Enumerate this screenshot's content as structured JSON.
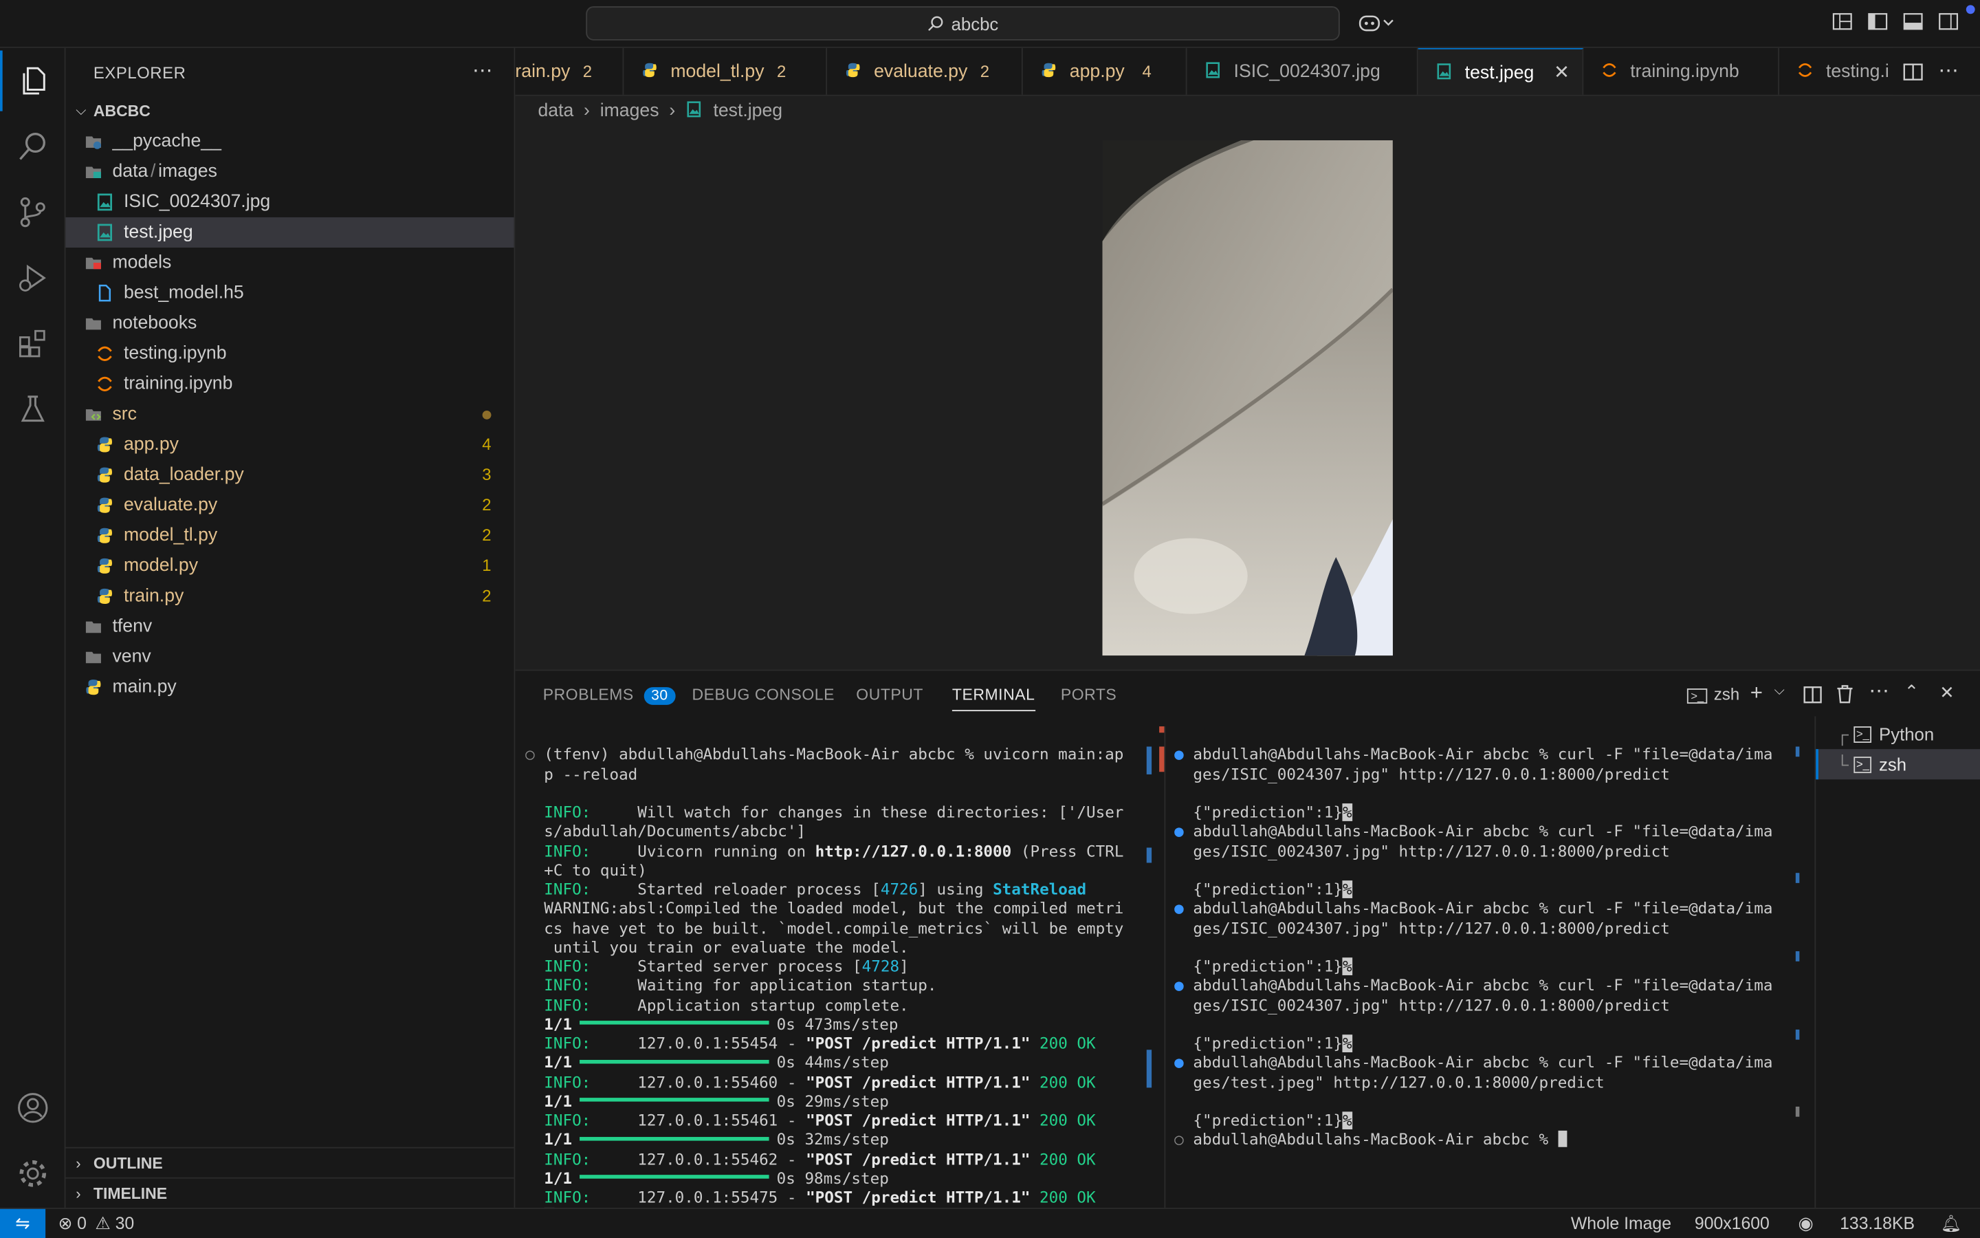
{
  "titlebar": {
    "search_text": "abcbc"
  },
  "sidebar": {
    "title": "EXPLORER",
    "root": "ABCBC",
    "items": [
      {
        "label": "__pycache__",
        "badge": ""
      },
      {
        "label_a": "data",
        "label_sep": "/",
        "label_b": "images",
        "badge": ""
      },
      {
        "label": "ISIC_0024307.jpg",
        "badge": ""
      },
      {
        "label": "test.jpeg",
        "badge": ""
      },
      {
        "label": "models",
        "badge": ""
      },
      {
        "label": "best_model.h5",
        "badge": ""
      },
      {
        "label": "notebooks",
        "badge": ""
      },
      {
        "label": "testing.ipynb",
        "badge": ""
      },
      {
        "label": "training.ipynb",
        "badge": ""
      },
      {
        "label": "src",
        "badge": ""
      },
      {
        "label": "app.py",
        "badge": "4"
      },
      {
        "label": "data_loader.py",
        "badge": "3"
      },
      {
        "label": "evaluate.py",
        "badge": "2"
      },
      {
        "label": "model_tl.py",
        "badge": "2"
      },
      {
        "label": "model.py",
        "badge": "1"
      },
      {
        "label": "train.py",
        "badge": "2"
      },
      {
        "label": "tfenv",
        "badge": ""
      },
      {
        "label": "venv",
        "badge": ""
      },
      {
        "label": "main.py",
        "badge": ""
      }
    ],
    "outline": "OUTLINE",
    "timeline": "TIMELINE"
  },
  "tabs": [
    {
      "label": "rain.py",
      "badge": "2"
    },
    {
      "label": "model_tl.py",
      "badge": "2"
    },
    {
      "label": "evaluate.py",
      "badge": "2"
    },
    {
      "label": "app.py",
      "badge": "4"
    },
    {
      "label": "ISIC_0024307.jpg",
      "badge": ""
    },
    {
      "label": "test.jpeg",
      "badge": ""
    },
    {
      "label": "training.ipynb",
      "badge": ""
    },
    {
      "label": "testing.i",
      "badge": ""
    }
  ],
  "breadcrumb": [
    "data",
    "images",
    "test.jpeg"
  ],
  "panel": {
    "tabs": [
      "PROBLEMS",
      "DEBUG CONSOLE",
      "OUTPUT",
      "TERMINAL",
      "PORTS"
    ],
    "problems_count": "30",
    "shell_label": "zsh",
    "terminals": [
      "Python",
      "zsh"
    ]
  },
  "terminal_left": {
    "l1": "(tfenv) abdullah@Abdullahs-MacBook-Air abcbc % uvicorn main:ap",
    "l2": "p --reload",
    "info_prefix": "INFO:",
    "l3": "     Will watch for changes in these directories: ['/User",
    "l4": "s/abdullah/Documents/abcbc']",
    "l5a": "     Uvicorn running on ",
    "l5b": "http://127.0.0.1:8000",
    "l5c": " (Press CTRL",
    "l6": "+C to quit)",
    "l7a": "     Started reloader process [",
    "l7b": "4726",
    "l7c": "] using ",
    "l7d": "StatReload",
    "l8": "WARNING:absl:Compiled the loaded model, but the compiled metri",
    "l9": "cs have yet to be built. `model.compile_metrics` will be empty",
    "l10": " until you train or evaluate the model.",
    "l11a": "     Started server process [",
    "l11b": "4728",
    "l11c": "]",
    "l12": "     Waiting for application startup.",
    "l13": "     Application startup complete.",
    "step_prefix": "1/1",
    "steps": [
      "0s 473ms/step",
      "0s 44ms/step",
      "0s 29ms/step",
      "0s 32ms/step",
      "0s 98ms/step"
    ],
    "posts": [
      "     127.0.0.1:55454 - ",
      "     127.0.0.1:55460 - ",
      "     127.0.0.1:55461 - ",
      "     127.0.0.1:55462 - ",
      "     127.0.0.1:55475 - "
    ],
    "post_req": "\"POST /predict HTTP/1.1\"",
    "post_status": " 200 OK"
  },
  "terminal_right": {
    "prompt": "abdullah@Abdullahs-MacBook-Air abcbc % ",
    "cmd_a1": "curl -F \"file=@data/ima",
    "cmd_a2": "ges/ISIC_0024307.jpg\" http://127.0.0.1:8000/predict",
    "cmd_b2": "ges/test.jpeg\" http://127.0.0.1:8000/predict",
    "response": "{\"prediction\":1}",
    "percent": "%"
  },
  "statusbar": {
    "errors": "0",
    "warnings": "30",
    "zoom": "Whole Image",
    "dims": "900x1600",
    "size": "133.18KB"
  },
  "colors": {
    "accent": "#0078d4",
    "warning": "#cca700",
    "python": "#e2c08d",
    "green": "#23d18b"
  }
}
